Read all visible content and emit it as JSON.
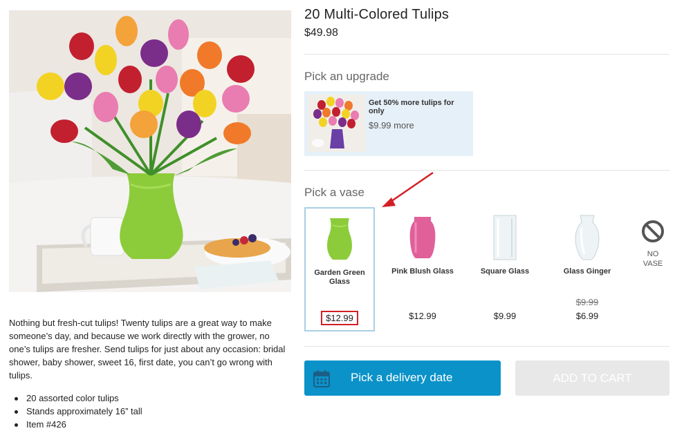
{
  "product": {
    "title": "20 Multi-Colored Tulips",
    "price": "$49.98",
    "description": "Nothing but fresh-cut tulips! Twenty tulips are a great way to make someone’s day, and because we work directly with the grower, no one’s tulips are fresher. Send tulips for just about any occasion: bridal shower, baby shower, sweet 16, first date, you can’t go wrong with tulips.",
    "features": [
      "20 assorted color tulips",
      "Stands approximately 16” tall",
      "Item #426"
    ]
  },
  "upgrade": {
    "heading": "Pick an upgrade",
    "title": "Get 50% more tulips for only",
    "price": "$9.99 more"
  },
  "vase": {
    "heading": "Pick a vase",
    "options": [
      {
        "name": "Garden Green Glass",
        "price": "$12.99",
        "original_price": "",
        "selected": true,
        "color": "#8ccc3a"
      },
      {
        "name": "Pink Blush Glass",
        "price": "$12.99",
        "original_price": "",
        "selected": false,
        "color": "#e0609a"
      },
      {
        "name": "Square Glass",
        "price": "$9.99",
        "original_price": "",
        "selected": false,
        "color": "#e4ecef"
      },
      {
        "name": "Glass Ginger",
        "price": "$6.99",
        "original_price": "$9.99",
        "selected": false,
        "color": "#e4ecef"
      }
    ],
    "no_vase": {
      "label_line1": "NO",
      "label_line2": "VASE",
      "icon": "no-symbol-icon"
    }
  },
  "actions": {
    "delivery_label": "Pick a delivery date",
    "delivery_icon": "calendar-icon",
    "cart_label": "ADD TO CART"
  },
  "colors": {
    "accent_blue": "#0b92c9",
    "selection_border": "#a9cfe4",
    "annotation_red": "#d21f25",
    "disabled_button": "#e8e8e8",
    "upgrade_bg": "#e6f0f8"
  }
}
